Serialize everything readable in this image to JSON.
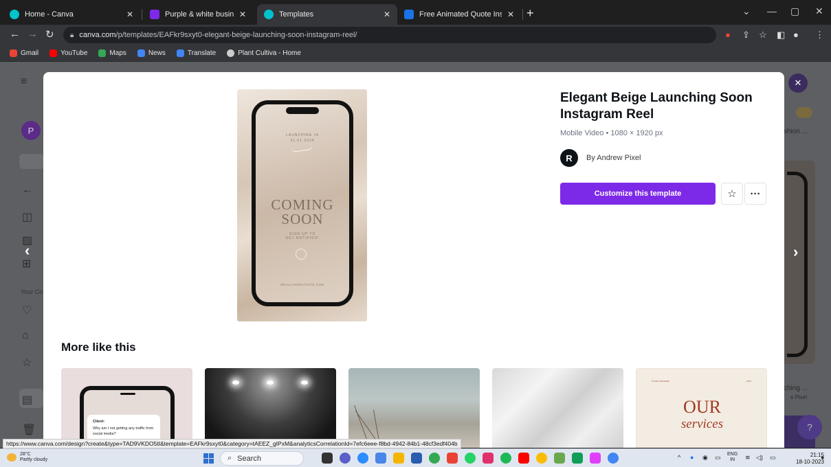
{
  "browser": {
    "tabs": [
      {
        "title": "Home - Canva",
        "favicon_color": "#00c4cc",
        "active": false
      },
      {
        "title": "Purple & white business profile i",
        "favicon_color": "#7d2ae8",
        "active": false
      },
      {
        "title": "Templates",
        "favicon_color": "#00c4cc",
        "active": true
      },
      {
        "title": "Free Animated Quote Instagram",
        "favicon_color": "#1a73e8",
        "active": false
      }
    ],
    "new_tab_label": "+",
    "url_host": "canva.com",
    "url_path": "/p/templates/EAFkr9sxyt0-elegant-beige-launching-soon-instagram-reel/",
    "bookmarks": [
      {
        "label": "Gmail",
        "color": "#ea4335"
      },
      {
        "label": "YouTube",
        "color": "#ff0000"
      },
      {
        "label": "Maps",
        "color": "#34a853"
      },
      {
        "label": "News",
        "color": "#4285f4"
      },
      {
        "label": "Translate",
        "color": "#4285f4"
      },
      {
        "label": "Plant Cultiva - Home",
        "color": "#cccccc"
      }
    ]
  },
  "background": {
    "avatar_letter": "P",
    "sidebar_label": "Your Co",
    "right_text_1": "shion ...",
    "right_text_2": "ching ...",
    "right_text_3": "e Pixel",
    "help_label": "?"
  },
  "template": {
    "title": "Elegant Beige Launching Soon Instagram Reel",
    "meta": "Mobile Video • 1080 × 1920 px",
    "author": "By Andrew Pixel",
    "author_initial": "R",
    "cta": "Customize this template",
    "preview": {
      "launch_label": "LAUNCHING IN",
      "date": "01.01.2024",
      "coming": "COMING",
      "soon": "SOON",
      "signup_1": "SIGN UP TO",
      "signup_2": "GET NOTIFIED!",
      "site": "REALLYGREATSITE.COM"
    }
  },
  "more": {
    "title": "More like this",
    "card1_heading": "Client:",
    "card1_text": "Why am I not getting any traffic from social media?",
    "card5_header_left": "STUDIO SHODWE",
    "card5_header_right": "2030",
    "card5_our": "OUR",
    "card5_services": "services"
  },
  "status_url": "https://www.canva.com/design?create&type=TAD9VKDO5tI&template=EAFkr9sxyt0&category=tAEEZ_gIPxM&analyticsCorrelationId=7efc6eee-f8bd-4942-84b1-48cf3edf404b",
  "taskbar": {
    "temp": "28°C",
    "weather": "Partly cloudy",
    "search": "Search",
    "lang_1": "ENG",
    "lang_2": "IN",
    "time": "21:15",
    "date": "18-10-2023"
  },
  "colors": {
    "accent": "#7d2ae8",
    "overlay": "#5e5f63"
  }
}
